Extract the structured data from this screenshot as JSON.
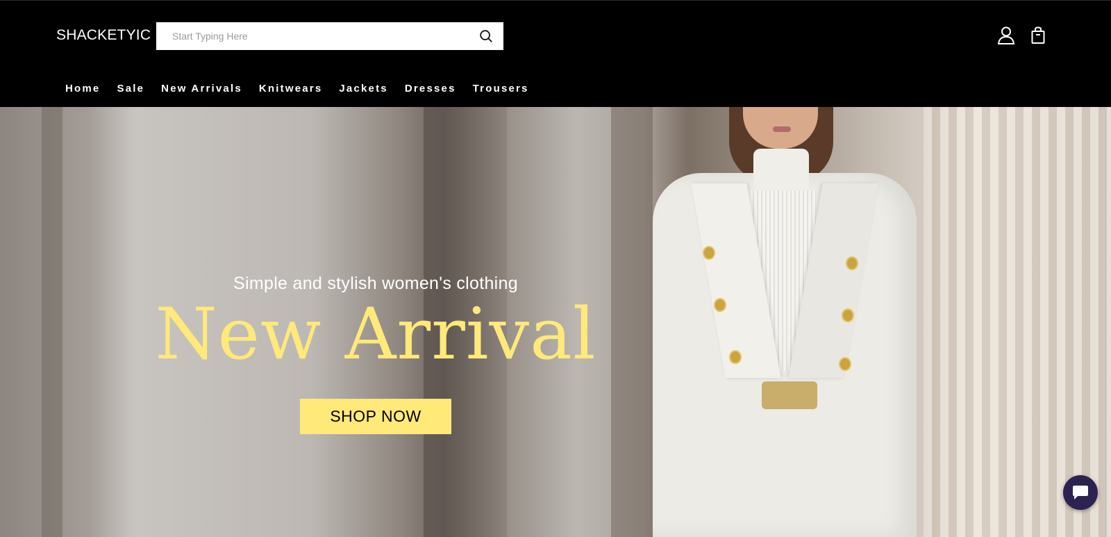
{
  "header": {
    "logo": "SHACKETYIC",
    "search": {
      "placeholder": "Start Typing Here",
      "value": ""
    },
    "icons": {
      "search": "search-icon",
      "account": "user-icon",
      "cart": "shopping-bag-icon"
    }
  },
  "nav": {
    "items": [
      {
        "label": "Home"
      },
      {
        "label": "Sale"
      },
      {
        "label": "New Arrivals"
      },
      {
        "label": "Knitwears"
      },
      {
        "label": "Jackets"
      },
      {
        "label": "Dresses"
      },
      {
        "label": "Trousers"
      }
    ]
  },
  "hero": {
    "subtitle": "Simple and stylish women's clothing",
    "title": "New Arrival",
    "cta": "SHOP NOW"
  },
  "chat": {
    "icon": "chat-bubble-icon"
  },
  "colors": {
    "header_bg": "#000000",
    "accent_yellow": "#ffe979",
    "chat_bg": "#2c2350"
  }
}
